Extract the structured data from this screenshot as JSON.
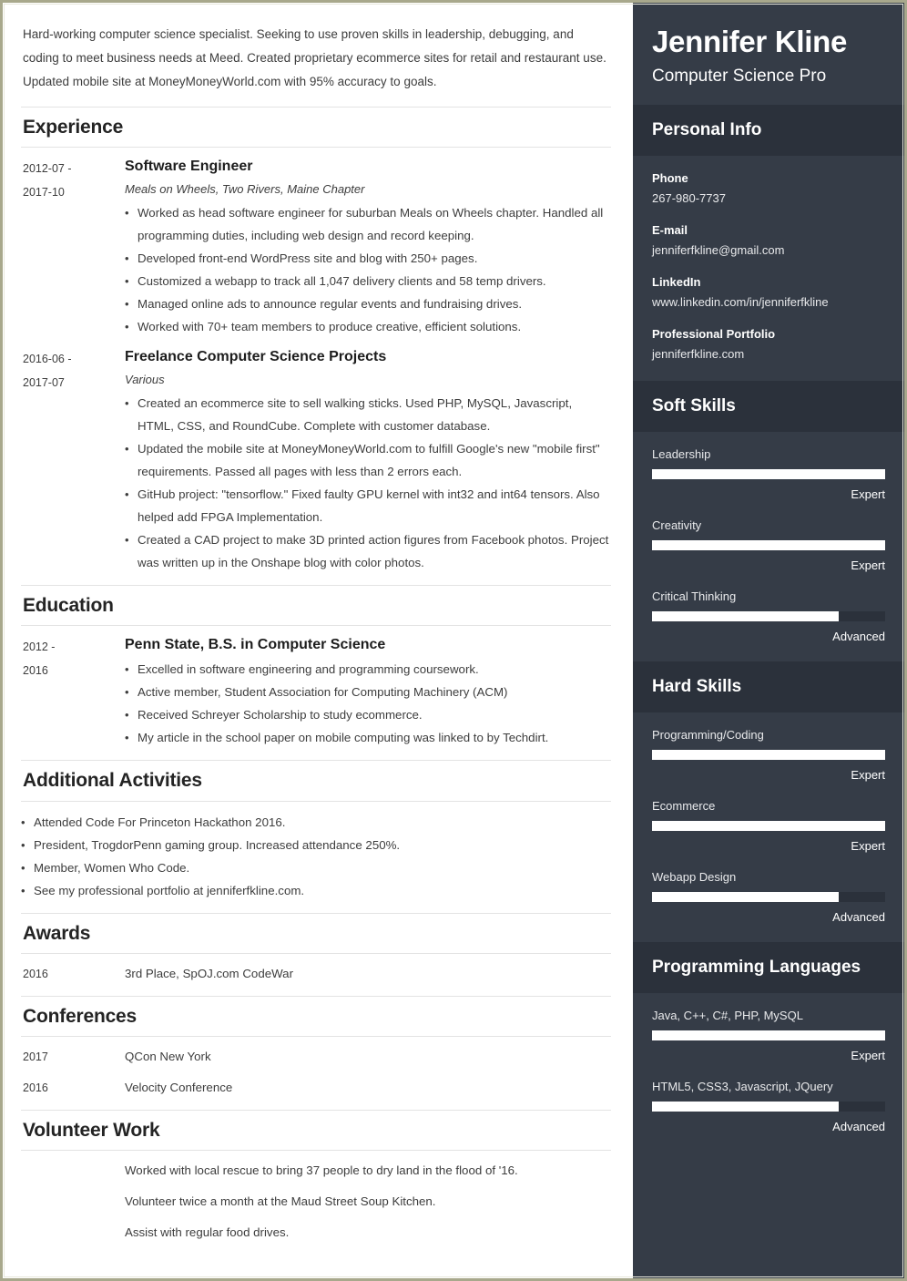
{
  "theme": {
    "sidebar_bg": "#353c47",
    "sidebar_header_bg": "#2b313b",
    "page_border": "#a8a88c",
    "bar_fill": "#ffffff",
    "text_dark": "#3d3d3d"
  },
  "main": {
    "summary": "Hard-working computer science specialist. Seeking to use proven skills in leadership, debugging, and coding to meet business needs at Meed. Created proprietary ecommerce sites for retail and restaurant use. Updated mobile site at MoneyMoneyWorld.com with 95% accuracy to goals.",
    "sections": {
      "experience": {
        "title": "Experience",
        "entries": [
          {
            "date_line1": "2012-07 -",
            "date_line2": "2017-10",
            "title": "Software Engineer",
            "subtitle": "Meals on Wheels, Two Rivers, Maine Chapter",
            "bullets": [
              "Worked as head software engineer for suburban Meals on Wheels chapter. Handled all programming duties, including web design and record keeping.",
              "Developed front-end WordPress site and blog with 250+ pages.",
              "Customized a webapp to track all 1,047 delivery clients and 58 temp drivers.",
              "Managed online ads to announce regular events and fundraising drives.",
              "Worked with 70+ team members to produce creative, efficient solutions."
            ]
          },
          {
            "date_line1": "2016-06 -",
            "date_line2": "2017-07",
            "title": "Freelance Computer Science Projects",
            "subtitle": "Various",
            "bullets": [
              "Created an ecommerce site to sell walking sticks. Used PHP, MySQL, Javascript, HTML, CSS, and RoundCube. Complete with customer database.",
              "Updated the mobile site at MoneyMoneyWorld.com to fulfill Google's new \"mobile first\" requirements. Passed all pages with less than 2 errors each.",
              "GitHub project: \"tensorflow.\" Fixed faulty GPU kernel with int32 and int64 tensors. Also helped add FPGA Implementation.",
              "Created a CAD project to make 3D printed action figures from Facebook photos. Project was written up in the Onshape blog with color photos."
            ]
          }
        ]
      },
      "education": {
        "title": "Education",
        "entries": [
          {
            "date_line1": "2012 -",
            "date_line2": "2016",
            "title": "Penn State, B.S. in Computer Science",
            "subtitle": "",
            "bullets": [
              "Excelled in software engineering and programming coursework.",
              "Active member, Student Association for Computing Machinery (ACM)",
              "Received Schreyer Scholarship to study ecommerce.",
              "My article in the school paper on mobile computing was linked to by Techdirt."
            ]
          }
        ]
      },
      "additional_activities": {
        "title": "Additional Activities",
        "bullets": [
          "Attended Code For Princeton Hackathon 2016.",
          "President, TrogdorPenn gaming group. Increased attendance 250%.",
          "Member, Women Who Code.",
          "See my professional portfolio at jenniferfkline.com."
        ]
      },
      "awards": {
        "title": "Awards",
        "rows": [
          {
            "year": "2016",
            "text": "3rd Place, SpOJ.com CodeWar"
          }
        ]
      },
      "conferences": {
        "title": "Conferences",
        "rows": [
          {
            "year": "2017",
            "text": "QCon New York"
          },
          {
            "year": "2016",
            "text": "Velocity Conference"
          }
        ]
      },
      "volunteer_work": {
        "title": "Volunteer Work",
        "lines": [
          "Worked with local rescue to bring 37 people to dry land in the flood of '16.",
          "Volunteer twice a month at the Maud Street Soup Kitchen.",
          "Assist with regular food drives."
        ]
      }
    }
  },
  "sidebar": {
    "name": "Jennifer Kline",
    "role": "Computer Science Pro",
    "personal_info": {
      "title": "Personal Info",
      "items": [
        {
          "label": "Phone",
          "value": "267-980-7737"
        },
        {
          "label": "E-mail",
          "value": "jenniferfkline@gmail.com"
        },
        {
          "label": "LinkedIn",
          "value": "www.linkedin.com/in/jenniferfkline"
        },
        {
          "label": "Professional Portfolio",
          "value": "jenniferfkline.com"
        }
      ]
    },
    "soft_skills": {
      "title": "Soft Skills",
      "items": [
        {
          "name": "Leadership",
          "level": "Expert",
          "percent": 100
        },
        {
          "name": "Creativity",
          "level": "Expert",
          "percent": 100
        },
        {
          "name": "Critical Thinking",
          "level": "Advanced",
          "percent": 80
        }
      ]
    },
    "hard_skills": {
      "title": "Hard Skills",
      "items": [
        {
          "name": "Programming/Coding",
          "level": "Expert",
          "percent": 100
        },
        {
          "name": "Ecommerce",
          "level": "Expert",
          "percent": 100
        },
        {
          "name": "Webapp Design",
          "level": "Advanced",
          "percent": 80
        }
      ]
    },
    "programming_languages": {
      "title": "Programming Languages",
      "items": [
        {
          "name": "Java, C++, C#, PHP, MySQL",
          "level": "Expert",
          "percent": 100
        },
        {
          "name": "HTML5, CSS3, Javascript, JQuery",
          "level": "Advanced",
          "percent": 80
        }
      ]
    }
  }
}
